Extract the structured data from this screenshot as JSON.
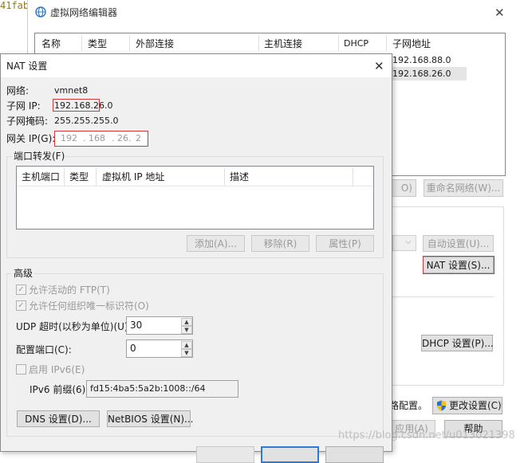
{
  "bg_text": "41fab",
  "back": {
    "title": "虚拟网络编辑器",
    "close": "✕",
    "columns": [
      "名称",
      "类型",
      "外部连接",
      "主机连接",
      "DHCP",
      "子网地址"
    ],
    "rows": [
      {
        "subnet": "192.168.88.0"
      },
      {
        "subnet": "192.168.26.0"
      }
    ],
    "rename_button": "重命名网络(W)...",
    "partial_button_o": "O)",
    "auto_settings_button": "自动设置(U)...",
    "nat_settings_button": "NAT 设置(S)...",
    "dhcp_settings_button": "DHCP 设置(P)...",
    "admin_text": "路配置。",
    "change_settings_button": "更改设置(C)",
    "apply_button": "应用(A)",
    "help_button": "帮助"
  },
  "nat": {
    "title": "NAT 设置",
    "close": "✕",
    "network_label": "网络:",
    "network_value": "vmnet8",
    "subnet_ip_label": "子网 IP:",
    "subnet_ip_value": "192.168.26.0",
    "subnet_mask_label": "子网掩码:",
    "subnet_mask_value": "255.255.255.0",
    "gateway_label": "网关 IP(G):",
    "gateway_octets": [
      "192",
      "168",
      "26",
      "2"
    ],
    "port_forwarding_label": "端口转发(F)",
    "pf_columns": [
      "主机端口",
      "类型",
      "虚拟机 IP 地址",
      "描述"
    ],
    "add_button": "添加(A)...",
    "remove_button": "移除(R)",
    "properties_button": "属性(P)",
    "advanced_label": "高级",
    "allow_ftp": "允许活动的 FTP(T)",
    "allow_oui": "允许任何组织唯一标识符(O)",
    "udp_timeout_label": "UDP 超时(以秒为单位)(U):",
    "udp_timeout_value": "30",
    "config_port_label": "配置端口(C):",
    "config_port_value": "0",
    "enable_ipv6": "启用 IPv6(E)",
    "ipv6_prefix_label": "IPv6 前缀(6):",
    "ipv6_prefix_value": "fd15:4ba5:5a2b:1008::/64",
    "dns_button": "DNS 设置(D)...",
    "netbios_button": "NetBIOS 设置(N)..."
  },
  "watermark": "https://blog.csdn.net/u013021398"
}
